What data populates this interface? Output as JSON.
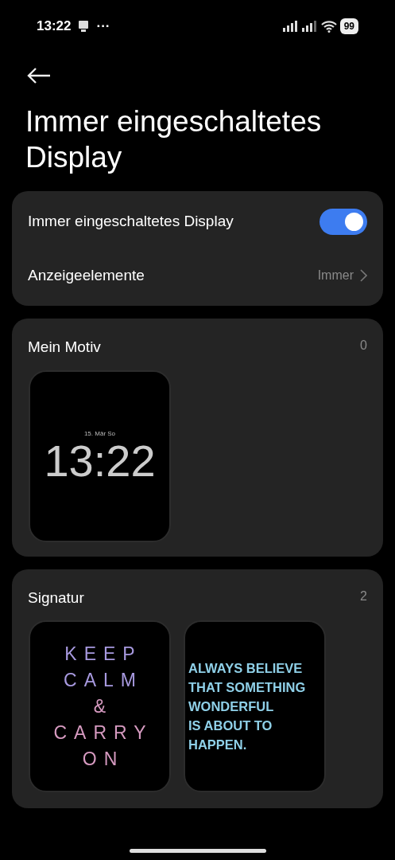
{
  "status_bar": {
    "time": "13:22",
    "more": "···",
    "battery": "99"
  },
  "title": "Immer eingeschaltetes Display",
  "settings": [
    {
      "kind": "toggle",
      "label": "Immer eingeschaltetes Display",
      "on": true
    },
    {
      "kind": "link",
      "label": "Anzeigeelemente",
      "value": "Immer"
    }
  ],
  "sections": [
    {
      "title": "Mein Motiv",
      "count": "0",
      "items": [
        {
          "kind": "clock",
          "date": "15. Mär So",
          "time": "13:22"
        }
      ]
    },
    {
      "title": "Signatur",
      "count": "2",
      "items": [
        {
          "kind": "spaced",
          "lines": [
            "KEEP",
            "CALM",
            "&",
            "CARRY",
            "ON"
          ]
        },
        {
          "kind": "bold",
          "lines": [
            "ALWAYS BELIEVE",
            "THAT SOMETHING",
            "WONDERFUL",
            "IS ABOUT TO",
            "HAPPEN."
          ]
        }
      ]
    }
  ]
}
